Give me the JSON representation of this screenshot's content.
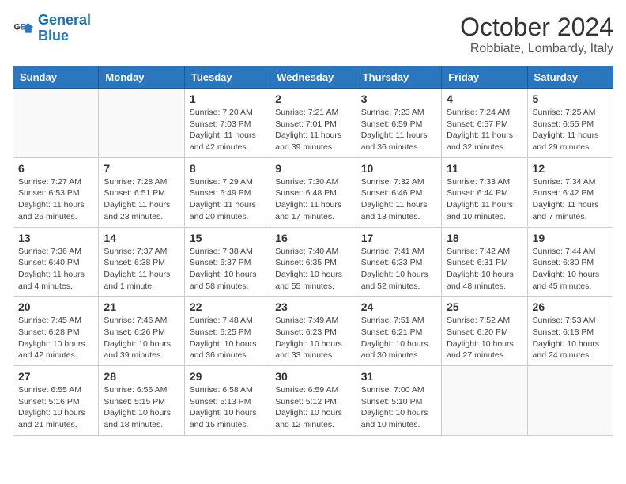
{
  "header": {
    "logo": {
      "line1": "General",
      "line2": "Blue"
    },
    "title": "October 2024",
    "subtitle": "Robbiate, Lombardy, Italy"
  },
  "weekdays": [
    "Sunday",
    "Monday",
    "Tuesday",
    "Wednesday",
    "Thursday",
    "Friday",
    "Saturday"
  ],
  "weeks": [
    [
      {
        "day": "",
        "sunrise": "",
        "sunset": "",
        "daylight": ""
      },
      {
        "day": "",
        "sunrise": "",
        "sunset": "",
        "daylight": ""
      },
      {
        "day": "1",
        "sunrise": "Sunrise: 7:20 AM",
        "sunset": "Sunset: 7:03 PM",
        "daylight": "Daylight: 11 hours and 42 minutes."
      },
      {
        "day": "2",
        "sunrise": "Sunrise: 7:21 AM",
        "sunset": "Sunset: 7:01 PM",
        "daylight": "Daylight: 11 hours and 39 minutes."
      },
      {
        "day": "3",
        "sunrise": "Sunrise: 7:23 AM",
        "sunset": "Sunset: 6:59 PM",
        "daylight": "Daylight: 11 hours and 36 minutes."
      },
      {
        "day": "4",
        "sunrise": "Sunrise: 7:24 AM",
        "sunset": "Sunset: 6:57 PM",
        "daylight": "Daylight: 11 hours and 32 minutes."
      },
      {
        "day": "5",
        "sunrise": "Sunrise: 7:25 AM",
        "sunset": "Sunset: 6:55 PM",
        "daylight": "Daylight: 11 hours and 29 minutes."
      }
    ],
    [
      {
        "day": "6",
        "sunrise": "Sunrise: 7:27 AM",
        "sunset": "Sunset: 6:53 PM",
        "daylight": "Daylight: 11 hours and 26 minutes."
      },
      {
        "day": "7",
        "sunrise": "Sunrise: 7:28 AM",
        "sunset": "Sunset: 6:51 PM",
        "daylight": "Daylight: 11 hours and 23 minutes."
      },
      {
        "day": "8",
        "sunrise": "Sunrise: 7:29 AM",
        "sunset": "Sunset: 6:49 PM",
        "daylight": "Daylight: 11 hours and 20 minutes."
      },
      {
        "day": "9",
        "sunrise": "Sunrise: 7:30 AM",
        "sunset": "Sunset: 6:48 PM",
        "daylight": "Daylight: 11 hours and 17 minutes."
      },
      {
        "day": "10",
        "sunrise": "Sunrise: 7:32 AM",
        "sunset": "Sunset: 6:46 PM",
        "daylight": "Daylight: 11 hours and 13 minutes."
      },
      {
        "day": "11",
        "sunrise": "Sunrise: 7:33 AM",
        "sunset": "Sunset: 6:44 PM",
        "daylight": "Daylight: 11 hours and 10 minutes."
      },
      {
        "day": "12",
        "sunrise": "Sunrise: 7:34 AM",
        "sunset": "Sunset: 6:42 PM",
        "daylight": "Daylight: 11 hours and 7 minutes."
      }
    ],
    [
      {
        "day": "13",
        "sunrise": "Sunrise: 7:36 AM",
        "sunset": "Sunset: 6:40 PM",
        "daylight": "Daylight: 11 hours and 4 minutes."
      },
      {
        "day": "14",
        "sunrise": "Sunrise: 7:37 AM",
        "sunset": "Sunset: 6:38 PM",
        "daylight": "Daylight: 11 hours and 1 minute."
      },
      {
        "day": "15",
        "sunrise": "Sunrise: 7:38 AM",
        "sunset": "Sunset: 6:37 PM",
        "daylight": "Daylight: 10 hours and 58 minutes."
      },
      {
        "day": "16",
        "sunrise": "Sunrise: 7:40 AM",
        "sunset": "Sunset: 6:35 PM",
        "daylight": "Daylight: 10 hours and 55 minutes."
      },
      {
        "day": "17",
        "sunrise": "Sunrise: 7:41 AM",
        "sunset": "Sunset: 6:33 PM",
        "daylight": "Daylight: 10 hours and 52 minutes."
      },
      {
        "day": "18",
        "sunrise": "Sunrise: 7:42 AM",
        "sunset": "Sunset: 6:31 PM",
        "daylight": "Daylight: 10 hours and 48 minutes."
      },
      {
        "day": "19",
        "sunrise": "Sunrise: 7:44 AM",
        "sunset": "Sunset: 6:30 PM",
        "daylight": "Daylight: 10 hours and 45 minutes."
      }
    ],
    [
      {
        "day": "20",
        "sunrise": "Sunrise: 7:45 AM",
        "sunset": "Sunset: 6:28 PM",
        "daylight": "Daylight: 10 hours and 42 minutes."
      },
      {
        "day": "21",
        "sunrise": "Sunrise: 7:46 AM",
        "sunset": "Sunset: 6:26 PM",
        "daylight": "Daylight: 10 hours and 39 minutes."
      },
      {
        "day": "22",
        "sunrise": "Sunrise: 7:48 AM",
        "sunset": "Sunset: 6:25 PM",
        "daylight": "Daylight: 10 hours and 36 minutes."
      },
      {
        "day": "23",
        "sunrise": "Sunrise: 7:49 AM",
        "sunset": "Sunset: 6:23 PM",
        "daylight": "Daylight: 10 hours and 33 minutes."
      },
      {
        "day": "24",
        "sunrise": "Sunrise: 7:51 AM",
        "sunset": "Sunset: 6:21 PM",
        "daylight": "Daylight: 10 hours and 30 minutes."
      },
      {
        "day": "25",
        "sunrise": "Sunrise: 7:52 AM",
        "sunset": "Sunset: 6:20 PM",
        "daylight": "Daylight: 10 hours and 27 minutes."
      },
      {
        "day": "26",
        "sunrise": "Sunrise: 7:53 AM",
        "sunset": "Sunset: 6:18 PM",
        "daylight": "Daylight: 10 hours and 24 minutes."
      }
    ],
    [
      {
        "day": "27",
        "sunrise": "Sunrise: 6:55 AM",
        "sunset": "Sunset: 5:16 PM",
        "daylight": "Daylight: 10 hours and 21 minutes."
      },
      {
        "day": "28",
        "sunrise": "Sunrise: 6:56 AM",
        "sunset": "Sunset: 5:15 PM",
        "daylight": "Daylight: 10 hours and 18 minutes."
      },
      {
        "day": "29",
        "sunrise": "Sunrise: 6:58 AM",
        "sunset": "Sunset: 5:13 PM",
        "daylight": "Daylight: 10 hours and 15 minutes."
      },
      {
        "day": "30",
        "sunrise": "Sunrise: 6:59 AM",
        "sunset": "Sunset: 5:12 PM",
        "daylight": "Daylight: 10 hours and 12 minutes."
      },
      {
        "day": "31",
        "sunrise": "Sunrise: 7:00 AM",
        "sunset": "Sunset: 5:10 PM",
        "daylight": "Daylight: 10 hours and 10 minutes."
      },
      {
        "day": "",
        "sunrise": "",
        "sunset": "",
        "daylight": ""
      },
      {
        "day": "",
        "sunrise": "",
        "sunset": "",
        "daylight": ""
      }
    ]
  ]
}
